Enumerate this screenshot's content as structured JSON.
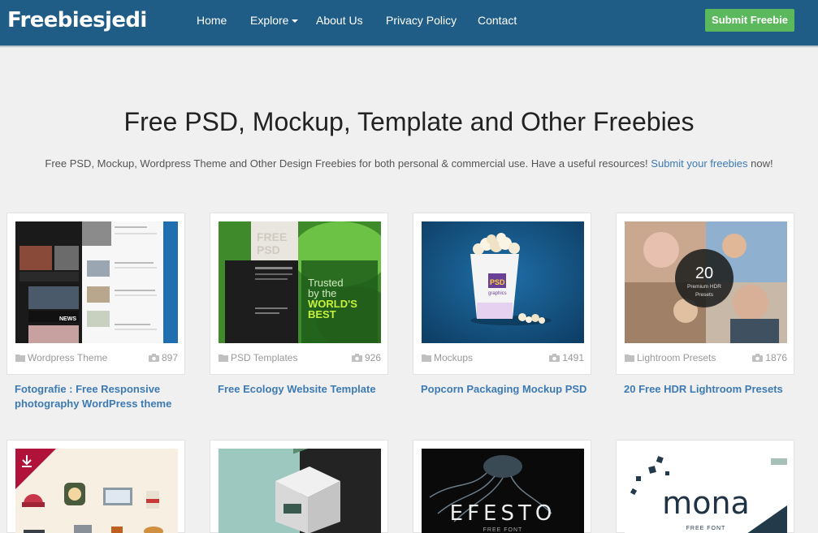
{
  "brand": {
    "logo": "Freebiesjedi"
  },
  "nav": {
    "home": "Home",
    "explore": "Explore",
    "about": "About Us",
    "privacy": "Privacy Policy",
    "contact": "Contact",
    "submit": "Submit Freebie"
  },
  "hero": {
    "title": "Free PSD, Mockup, Template and Other Freebies",
    "subtitle_before": "Free PSD, Mockup, Wordpress Theme and Other Design Freebies for both personal & commercial use. Have a useful resources!",
    "subtitle_link": "Submit your freebies",
    "subtitle_after": "now!"
  },
  "cards": [
    {
      "category": "Wordpress Theme",
      "views": "897",
      "title": "Fotografie : Free Responsive photography WordPress theme"
    },
    {
      "category": "PSD Templates",
      "views": "926",
      "title": "Free Ecology Website Template"
    },
    {
      "category": "Mockups",
      "views": "1491",
      "title": "Popcorn Packaging Mockup PSD"
    },
    {
      "category": "Lightroom Presets",
      "views": "1876",
      "title": "20 Free HDR Lightroom Presets"
    }
  ],
  "thumb_text": {
    "t1_news": "NEWS",
    "t2_free": "FREE",
    "t2_psd": "PSD",
    "t2_trusted": "Trusted",
    "t2_bythe": "by the",
    "t2_worlds": "WORLD'S",
    "t2_best": "BEST",
    "t3_brand": "PSD",
    "t3_brand_sub": "graphics",
    "t4_num": "20",
    "t4_line1": "Premium HDR",
    "t4_line2": "Presets",
    "t7_title": "EFESTO",
    "t7_sub": "FREE FONT",
    "t8_title": "mona",
    "t8_sub": "FREE FONT"
  },
  "icons": {
    "folder": "folder-icon",
    "camera": "camera-icon",
    "download": "download-icon",
    "dropdown": "caret-down-icon"
  },
  "colors": {
    "header": "#1f5d86",
    "submit": "#5cb85c",
    "link": "#3d7ab3",
    "background": "#f0f0f0"
  }
}
